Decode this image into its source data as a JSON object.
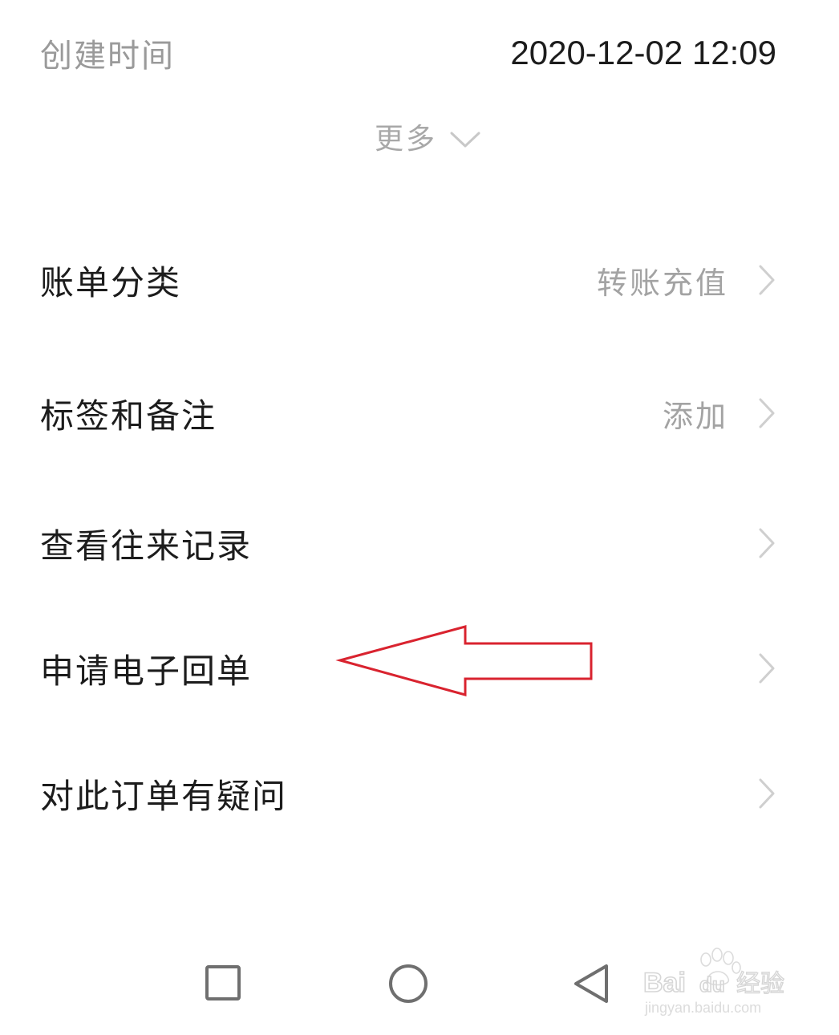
{
  "created": {
    "label": "创建时间",
    "value": "2020-12-02 12:09"
  },
  "more": {
    "label": "更多",
    "icon": "chevron-down-icon"
  },
  "menu": [
    {
      "label": "账单分类",
      "value": "转账充值",
      "icon": "chevron-right-icon"
    },
    {
      "label": "标签和备注",
      "value": "添加",
      "icon": "chevron-right-icon"
    },
    {
      "label": "查看往来记录",
      "value": "",
      "icon": "chevron-right-icon"
    },
    {
      "label": "申请电子回单",
      "value": "",
      "icon": "chevron-right-icon"
    },
    {
      "label": "对此订单有疑问",
      "value": "",
      "icon": "chevron-right-icon"
    }
  ],
  "annotation": {
    "arrow_color": "#d9232f",
    "points_to": "申请电子回单"
  },
  "navbar": {
    "recent_icon": "square-icon",
    "home_icon": "circle-icon",
    "back_icon": "triangle-back-icon"
  },
  "watermark": {
    "brand": "Baidu经验",
    "url": "jingyan.baidu.com"
  },
  "colors": {
    "primary_text": "#1c1c1c",
    "secondary_text": "#a3a3a3",
    "chevron": "#cfcfcf",
    "background": "#ffffff"
  }
}
